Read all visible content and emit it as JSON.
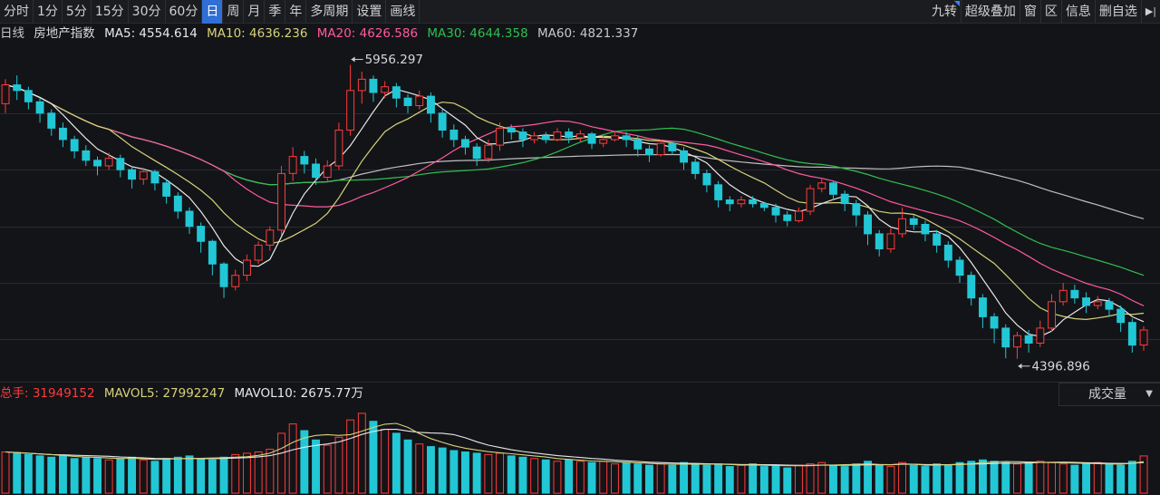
{
  "toolbar": {
    "periods": [
      "分时",
      "1分",
      "5分",
      "15分",
      "30分",
      "60分",
      "日",
      "周",
      "月",
      "季",
      "年",
      "多周期",
      "设置",
      "画线"
    ],
    "active_period": "日",
    "right_items": [
      "九转",
      "超级叠加",
      "窗",
      "区",
      "信息",
      "删自选"
    ],
    "collapse_icon": "collapse-right-icon"
  },
  "legend": {
    "period_label": "日线",
    "index_name": "房地产指数",
    "ma5": "MA5: 4554.614",
    "ma10": "MA10: 4636.236",
    "ma20": "MA20: 4626.586",
    "ma30": "MA30: 4644.358",
    "ma60": "MA60: 4821.337"
  },
  "volume_legend": {
    "total": "总手: 31949152",
    "mavol5": "MAVOL5: 27992247",
    "mavol10": "MAVOL10: 2675.77万",
    "indicator_select": "成交量"
  },
  "colors": {
    "up": "#ff3b3b",
    "down": "#22c7d6",
    "ma5": "#e8e8e8",
    "ma10": "#d6d27a",
    "ma20": "#ff5a9c",
    "ma30": "#2fbf4f",
    "ma60": "#bfbfbf",
    "grid": "#2a2b30",
    "background": "#131418"
  },
  "chart_data": {
    "type": "candlestick",
    "title": "房地产指数 日线",
    "high_marker": "5956.297",
    "low_marker": "4396.896",
    "ylim": [
      4300,
      6050
    ],
    "grid": true,
    "candles": [
      [
        5750,
        5850,
        5700,
        5880
      ],
      [
        5850,
        5820,
        5770,
        5900
      ],
      [
        5820,
        5760,
        5720,
        5840
      ],
      [
        5760,
        5700,
        5650,
        5780
      ],
      [
        5700,
        5620,
        5580,
        5720
      ],
      [
        5620,
        5560,
        5520,
        5650
      ],
      [
        5560,
        5500,
        5460,
        5580
      ],
      [
        5500,
        5450,
        5420,
        5530
      ],
      [
        5450,
        5420,
        5370,
        5470
      ],
      [
        5420,
        5460,
        5400,
        5490
      ],
      [
        5460,
        5400,
        5360,
        5480
      ],
      [
        5400,
        5350,
        5300,
        5420
      ],
      [
        5350,
        5390,
        5320,
        5410
      ],
      [
        5390,
        5330,
        5290,
        5400
      ],
      [
        5330,
        5260,
        5220,
        5350
      ],
      [
        5260,
        5180,
        5140,
        5280
      ],
      [
        5180,
        5100,
        5060,
        5200
      ],
      [
        5100,
        5020,
        4960,
        5120
      ],
      [
        5020,
        4900,
        4840,
        5030
      ],
      [
        4900,
        4780,
        4720,
        4910
      ],
      [
        4780,
        4840,
        4760,
        4870
      ],
      [
        4840,
        4920,
        4810,
        4950
      ],
      [
        4920,
        5000,
        4900,
        5020
      ],
      [
        5000,
        5080,
        4970,
        5100
      ],
      [
        5080,
        5380,
        5050,
        5420
      ],
      [
        5380,
        5470,
        5340,
        5520
      ],
      [
        5470,
        5430,
        5380,
        5500
      ],
      [
        5430,
        5360,
        5320,
        5460
      ],
      [
        5360,
        5420,
        5340,
        5450
      ],
      [
        5420,
        5610,
        5400,
        5650
      ],
      [
        5610,
        5820,
        5580,
        5956
      ],
      [
        5820,
        5880,
        5750,
        5920
      ],
      [
        5880,
        5810,
        5760,
        5900
      ],
      [
        5810,
        5840,
        5780,
        5870
      ],
      [
        5840,
        5780,
        5730,
        5860
      ],
      [
        5780,
        5740,
        5700,
        5800
      ],
      [
        5740,
        5790,
        5720,
        5820
      ],
      [
        5790,
        5700,
        5650,
        5810
      ],
      [
        5700,
        5610,
        5570,
        5720
      ],
      [
        5610,
        5560,
        5520,
        5640
      ],
      [
        5560,
        5520,
        5480,
        5580
      ],
      [
        5520,
        5460,
        5420,
        5540
      ],
      [
        5460,
        5530,
        5440,
        5560
      ],
      [
        5530,
        5620,
        5500,
        5650
      ],
      [
        5620,
        5600,
        5560,
        5640
      ],
      [
        5600,
        5560,
        5520,
        5620
      ],
      [
        5560,
        5580,
        5540,
        5600
      ],
      [
        5580,
        5560,
        5540,
        5600
      ],
      [
        5560,
        5600,
        5550,
        5620
      ],
      [
        5600,
        5570,
        5540,
        5620
      ],
      [
        5570,
        5590,
        5550,
        5610
      ],
      [
        5590,
        5540,
        5510,
        5600
      ],
      [
        5540,
        5560,
        5520,
        5580
      ],
      [
        5560,
        5580,
        5550,
        5600
      ],
      [
        5580,
        5560,
        5520,
        5600
      ],
      [
        5560,
        5510,
        5470,
        5580
      ],
      [
        5510,
        5480,
        5440,
        5530
      ],
      [
        5480,
        5540,
        5470,
        5560
      ],
      [
        5540,
        5500,
        5480,
        5550
      ],
      [
        5500,
        5440,
        5400,
        5520
      ],
      [
        5440,
        5380,
        5350,
        5460
      ],
      [
        5380,
        5320,
        5280,
        5400
      ],
      [
        5320,
        5240,
        5200,
        5340
      ],
      [
        5240,
        5220,
        5180,
        5260
      ],
      [
        5220,
        5240,
        5200,
        5260
      ],
      [
        5240,
        5220,
        5200,
        5260
      ],
      [
        5220,
        5200,
        5180,
        5230
      ],
      [
        5200,
        5160,
        5120,
        5220
      ],
      [
        5160,
        5130,
        5100,
        5180
      ],
      [
        5130,
        5180,
        5120,
        5200
      ],
      [
        5180,
        5300,
        5160,
        5320
      ],
      [
        5300,
        5330,
        5280,
        5350
      ],
      [
        5330,
        5270,
        5240,
        5340
      ],
      [
        5270,
        5220,
        5180,
        5290
      ],
      [
        5220,
        5160,
        5100,
        5240
      ],
      [
        5160,
        5060,
        5000,
        5180
      ],
      [
        5060,
        4980,
        4940,
        5080
      ],
      [
        4980,
        5060,
        4960,
        5090
      ],
      [
        5060,
        5140,
        5040,
        5200
      ],
      [
        5140,
        5110,
        5080,
        5160
      ],
      [
        5110,
        5060,
        5020,
        5130
      ],
      [
        5060,
        5000,
        4960,
        5080
      ],
      [
        5000,
        4920,
        4880,
        5020
      ],
      [
        4920,
        4840,
        4800,
        4940
      ],
      [
        4840,
        4720,
        4680,
        4860
      ],
      [
        4720,
        4620,
        4560,
        4740
      ],
      [
        4620,
        4560,
        4480,
        4640
      ],
      [
        4560,
        4460,
        4400,
        4580
      ],
      [
        4460,
        4520,
        4397,
        4540
      ],
      [
        4520,
        4480,
        4430,
        4550
      ],
      [
        4480,
        4560,
        4460,
        4600
      ],
      [
        4560,
        4700,
        4540,
        4740
      ],
      [
        4700,
        4760,
        4680,
        4800
      ],
      [
        4760,
        4720,
        4690,
        4790
      ],
      [
        4720,
        4680,
        4640,
        4750
      ],
      [
        4680,
        4700,
        4660,
        4730
      ],
      [
        4700,
        4660,
        4620,
        4720
      ],
      [
        4660,
        4590,
        4540,
        4680
      ],
      [
        4590,
        4470,
        4430,
        4610
      ],
      [
        4470,
        4550,
        4440,
        4570
      ]
    ],
    "volumes": [
      31,
      30,
      29,
      28,
      27,
      28,
      26,
      27,
      26,
      25,
      26,
      27,
      25,
      24,
      26,
      27,
      28,
      26,
      25,
      27,
      29,
      30,
      31,
      33,
      45,
      52,
      47,
      40,
      36,
      42,
      55,
      60,
      54,
      48,
      45,
      40,
      37,
      35,
      34,
      32,
      31,
      30,
      29,
      30,
      28,
      27,
      26,
      25,
      24,
      25,
      24,
      23,
      24,
      22,
      23,
      22,
      21,
      22,
      21,
      23,
      22,
      21,
      22,
      20,
      21,
      22,
      20,
      21,
      19,
      21,
      22,
      23,
      21,
      20,
      22,
      24,
      21,
      20,
      23,
      21,
      20,
      22,
      21,
      23,
      24,
      25,
      24,
      23,
      22,
      23,
      24,
      23,
      22,
      21,
      22,
      23,
      22,
      21,
      24,
      28
    ]
  }
}
